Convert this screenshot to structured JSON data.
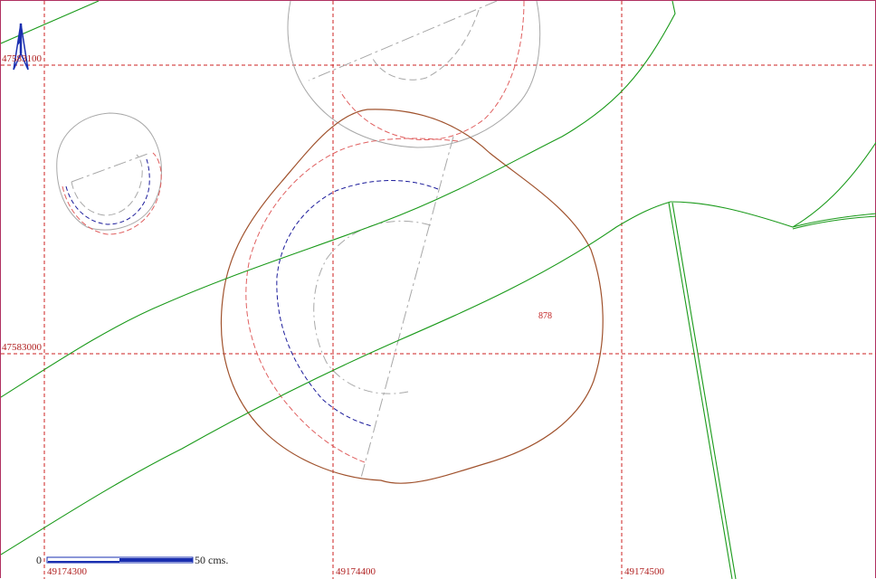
{
  "map": {
    "grid": {
      "x_labels": [
        "49174300",
        "49174400",
        "49174500"
      ],
      "y_labels": [
        "47583100",
        "47583000"
      ],
      "color": "#cc2222"
    },
    "parcel_label": "878",
    "scale": {
      "start_label": "0",
      "end_label": "50 cms."
    },
    "north_arrow": {
      "icon": "north-arrow-icon",
      "color": "#1a2fb0"
    },
    "colors": {
      "contour_brown": "#a0522d",
      "road_green": "#1a9a1a",
      "contour_gray": "#a8a8a8",
      "contour_red": "#e06060",
      "contour_blue": "#1a1a9a"
    }
  }
}
